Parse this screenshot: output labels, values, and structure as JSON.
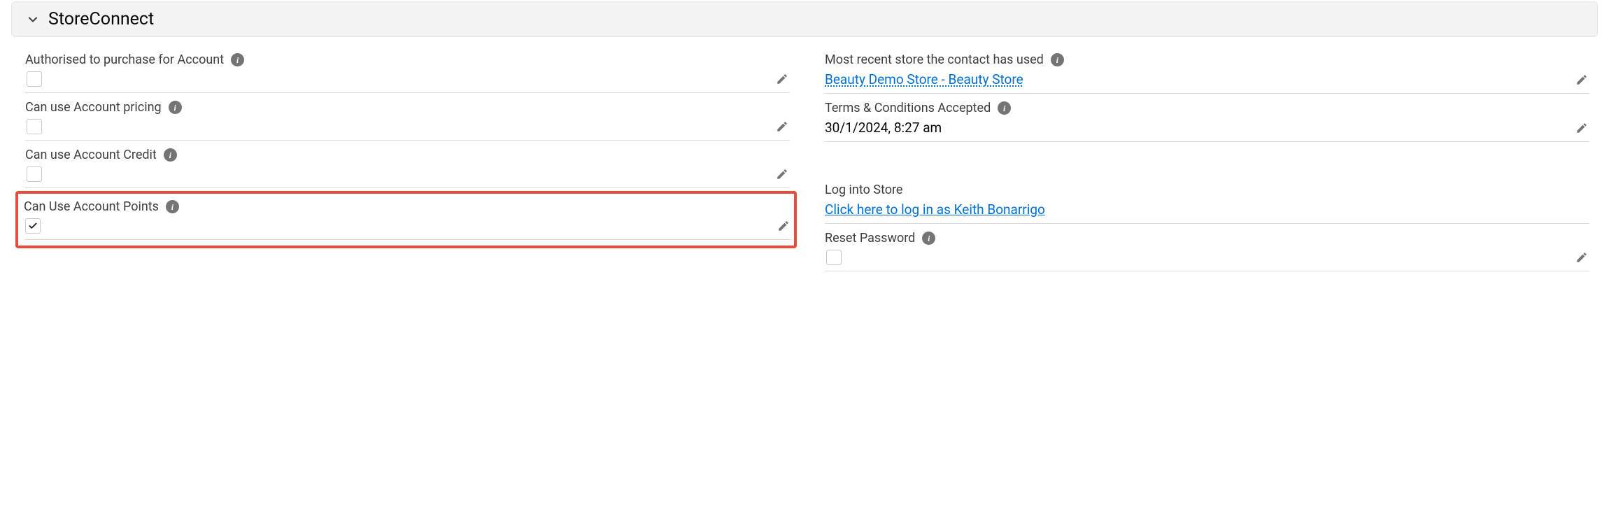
{
  "section": {
    "title": "StoreConnect"
  },
  "left": {
    "authorised": {
      "label": "Authorised to purchase for Account",
      "hasInfo": true,
      "checked": false,
      "editable": true
    },
    "pricing": {
      "label": "Can use Account pricing",
      "hasInfo": true,
      "checked": false,
      "editable": true
    },
    "credit": {
      "label": "Can use Account Credit",
      "hasInfo": true,
      "checked": false,
      "editable": true
    },
    "points": {
      "label": "Can Use Account Points",
      "hasInfo": true,
      "checked": true,
      "editable": true,
      "highlighted": true
    }
  },
  "right": {
    "recentStore": {
      "label": "Most recent store the contact has used",
      "hasInfo": true,
      "value": "Beauty Demo Store - Beauty Store",
      "editable": true,
      "link": true
    },
    "terms": {
      "label": "Terms & Conditions Accepted",
      "hasInfo": true,
      "value": "30/1/2024, 8:27 am",
      "editable": true
    },
    "login": {
      "label": "Log into Store",
      "hasInfo": false,
      "value": "Click here to log in as Keith Bonarrigo",
      "editable": false,
      "link": true
    },
    "reset": {
      "label": "Reset Password",
      "hasInfo": true,
      "checked": false,
      "editable": true
    }
  }
}
